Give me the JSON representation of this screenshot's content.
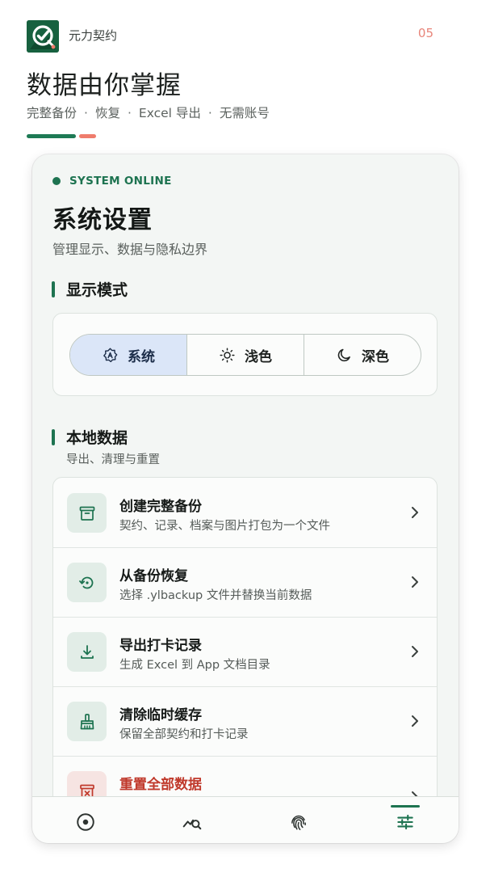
{
  "promo": {
    "app_name": "元力契约",
    "page_number": "05",
    "headline": "数据由你掌握",
    "features": [
      "完整备份",
      "恢复",
      "Excel 导出",
      "无需账号"
    ],
    "separator": "·"
  },
  "screen": {
    "status": "SYSTEM ONLINE",
    "title": "系统设置",
    "subtitle": "管理显示、数据与隐私边界",
    "display_section": {
      "label": "显示模式",
      "options": [
        {
          "label": "系统",
          "icon": "auto-brightness-icon",
          "selected": true
        },
        {
          "label": "浅色",
          "icon": "sun-icon",
          "selected": false
        },
        {
          "label": "深色",
          "icon": "moon-icon",
          "selected": false
        }
      ]
    },
    "data_section": {
      "label": "本地数据",
      "sublabel": "导出、清理与重置",
      "items": [
        {
          "title": "创建完整备份",
          "desc": "契约、记录、档案与图片打包为一个文件",
          "icon": "archive-box-icon"
        },
        {
          "title": "从备份恢复",
          "desc": "选择 .ylbackup 文件并替换当前数据",
          "icon": "restore-icon"
        },
        {
          "title": "导出打卡记录",
          "desc": "生成 Excel 到 App 文档目录",
          "icon": "download-icon"
        },
        {
          "title": "清除临时缓存",
          "desc": "保留全部契约和打卡记录",
          "icon": "broom-icon"
        },
        {
          "title": "重置全部数据",
          "desc": "",
          "icon": "delete-box-icon"
        }
      ]
    },
    "bottom_nav": [
      {
        "icon": "target-icon",
        "active": false
      },
      {
        "icon": "chart-search-icon",
        "active": false
      },
      {
        "icon": "fingerprint-icon",
        "active": false
      },
      {
        "icon": "sliders-icon",
        "active": true
      }
    ]
  },
  "colors": {
    "brand_green": "#1d7350",
    "accent_coral": "#ef7c6c",
    "danger_red": "#c0392b",
    "selected_segment": "#dbe6f8"
  }
}
